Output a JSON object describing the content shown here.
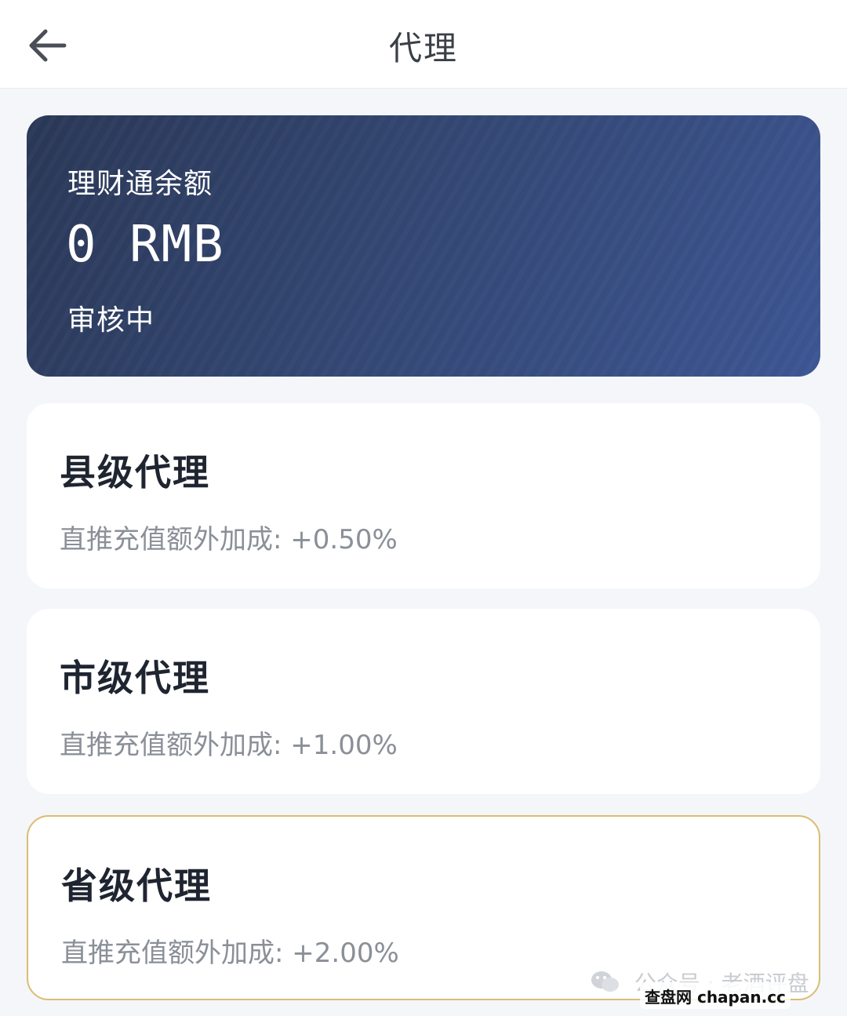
{
  "header": {
    "title": "代理",
    "back_icon": "arrow-left-icon"
  },
  "balance_card": {
    "label": "理财通余额",
    "amount": "0 RMB",
    "status": "审核中",
    "colors": {
      "gradient_start": "#2a3756",
      "gradient_end": "#3c5592"
    }
  },
  "levels": [
    {
      "title": "县级代理",
      "bonus": "直推充值额外加成: +0.50%",
      "selected": false
    },
    {
      "title": "市级代理",
      "bonus": "直推充值额外加成: +1.00%",
      "selected": false
    },
    {
      "title": "省级代理",
      "bonus": "直推充值额外加成: +2.00%",
      "selected": true
    }
  ],
  "colors": {
    "selected_border": "#d9bd72",
    "page_bg": "#f4f6fa"
  },
  "watermark": {
    "text": "公众号 · 老酒评盘",
    "site": "查盘网 chapan.cc"
  }
}
